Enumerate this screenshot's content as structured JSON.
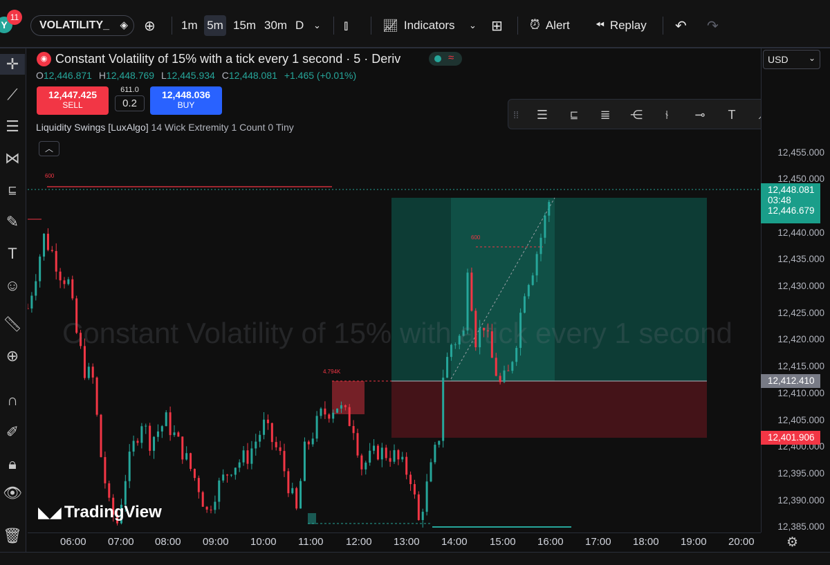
{
  "topbar": {
    "symbol": "VOLATILITY_",
    "badge": "11",
    "avatar": "Y",
    "intervals": [
      "1m",
      "5m",
      "15m",
      "30m",
      "D"
    ],
    "active_interval": "5m",
    "indicators": "Indicators",
    "alert": "Alert",
    "replay": "Replay"
  },
  "legend": {
    "title": "Constant Volatility of 15% with a tick every 1 second · 5 · Deriv",
    "o_label": "O",
    "o": "12,446.871",
    "h_label": "H",
    "h": "12,448.769",
    "l_label": "L",
    "l": "12,445.934",
    "c_label": "C",
    "c": "12,448.081",
    "change": "+1.465 (+0.01%)"
  },
  "trade": {
    "sell_price": "12,447.425",
    "sell_label": "SELL",
    "spread_top": "611.0",
    "spread": "0.2",
    "buy_price": "12,448.036",
    "buy_label": "BUY"
  },
  "indicator": {
    "name": "Liquidity Swings [LuxAlgo]",
    "params": "14 Wick Extremity 1 Count 0 Tiny"
  },
  "currency": "USD",
  "watermark": "Constant Volatility of 15% with a tick every 1 second",
  "brand": "TradingView",
  "price_ticks": [
    "12,455.000",
    "12,450.000",
    "12,440.000",
    "12,435.000",
    "12,430.000",
    "12,425.000",
    "12,420.000",
    "12,415.000",
    "12,410.000",
    "12,405.000",
    "12,400.000",
    "12,395.000",
    "12,390.000",
    "12,385.000"
  ],
  "time_ticks": [
    "06:00",
    "07:00",
    "08:00",
    "09:00",
    "10:00",
    "11:00",
    "12:00",
    "13:00",
    "14:00",
    "15:00",
    "16:00",
    "17:00",
    "18:00",
    "19:00",
    "20:00"
  ],
  "price_labels": {
    "last": "12,448.081",
    "countdown": "03:48",
    "tp_level": "12,446.679",
    "entry": "12,412.410",
    "stop": "12,401.906"
  },
  "annotations": {
    "swing_high_left": "600",
    "swing_high_mid": "600",
    "swing_zone": "4.794K"
  },
  "colors": {
    "bull": "#26a69a",
    "bear": "#f23645",
    "profit_zone": "#0e4a42",
    "loss_zone": "#4a1419"
  },
  "chart_data": {
    "type": "candlestick",
    "title": "Constant Volatility of 15% with a tick every 1 second · 5 · Deriv",
    "ylim": [
      12383,
      12478
    ],
    "x_range": [
      "05:30",
      "20:30"
    ],
    "close_series": [
      {
        "t": "05:30",
        "v": 12427
      },
      {
        "t": "05:50",
        "v": 12441
      },
      {
        "t": "06:00",
        "v": 12438
      },
      {
        "t": "06:10",
        "v": 12434
      },
      {
        "t": "06:20",
        "v": 12432
      },
      {
        "t": "06:30",
        "v": 12422
      },
      {
        "t": "06:40",
        "v": 12415
      },
      {
        "t": "06:50",
        "v": 12413
      },
      {
        "t": "07:00",
        "v": 12398
      },
      {
        "t": "07:10",
        "v": 12388
      },
      {
        "t": "07:20",
        "v": 12385
      },
      {
        "t": "07:30",
        "v": 12394
      },
      {
        "t": "07:40",
        "v": 12400
      },
      {
        "t": "07:50",
        "v": 12405
      },
      {
        "t": "08:00",
        "v": 12401
      },
      {
        "t": "08:20",
        "v": 12405
      },
      {
        "t": "08:40",
        "v": 12399
      },
      {
        "t": "09:00",
        "v": 12392
      },
      {
        "t": "09:10",
        "v": 12387
      },
      {
        "t": "09:20",
        "v": 12391
      },
      {
        "t": "09:40",
        "v": 12396
      },
      {
        "t": "10:00",
        "v": 12398
      },
      {
        "t": "10:20",
        "v": 12404
      },
      {
        "t": "10:40",
        "v": 12398
      },
      {
        "t": "11:00",
        "v": 12387
      },
      {
        "t": "11:10",
        "v": 12399
      },
      {
        "t": "11:30",
        "v": 12406
      },
      {
        "t": "11:50",
        "v": 12408
      },
      {
        "t": "12:10",
        "v": 12404
      },
      {
        "t": "12:20",
        "v": 12396
      },
      {
        "t": "12:40",
        "v": 12399
      },
      {
        "t": "13:00",
        "v": 12398
      },
      {
        "t": "13:20",
        "v": 12394
      },
      {
        "t": "13:30",
        "v": 12385
      },
      {
        "t": "13:40",
        "v": 12392
      },
      {
        "t": "13:55",
        "v": 12402
      },
      {
        "t": "14:00",
        "v": 12414
      },
      {
        "t": "14:10",
        "v": 12420
      },
      {
        "t": "14:25",
        "v": 12422
      },
      {
        "t": "14:30",
        "v": 12436
      },
      {
        "t": "14:40",
        "v": 12421
      },
      {
        "t": "14:50",
        "v": 12424
      },
      {
        "t": "15:00",
        "v": 12417
      },
      {
        "t": "15:10",
        "v": 12412
      },
      {
        "t": "15:20",
        "v": 12414
      },
      {
        "t": "15:30",
        "v": 12421
      },
      {
        "t": "15:40",
        "v": 12431
      },
      {
        "t": "15:50",
        "v": 12435
      },
      {
        "t": "16:00",
        "v": 12441
      },
      {
        "t": "16:10",
        "v": 12448
      }
    ]
  }
}
